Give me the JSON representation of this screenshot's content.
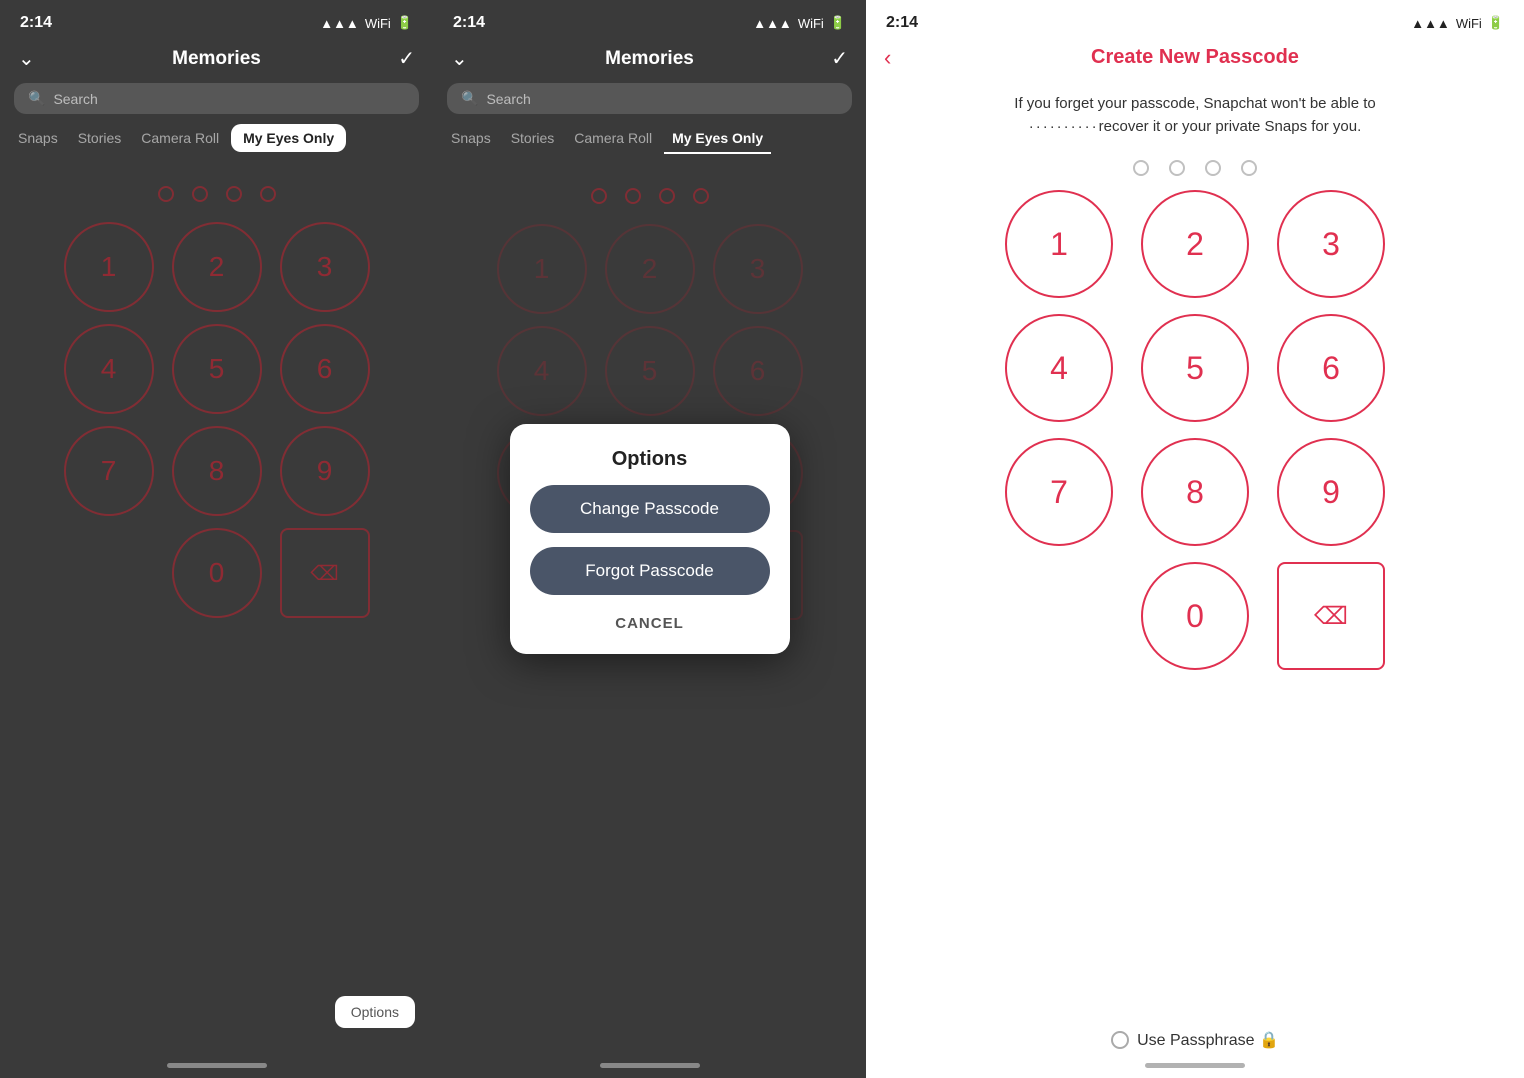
{
  "panel1": {
    "time": "2:14",
    "title": "Memories",
    "search_placeholder": "Search",
    "tabs": [
      "Snaps",
      "Stories",
      "Camera Roll",
      "My Eyes Only"
    ],
    "active_tab": "My Eyes Only",
    "options_label": "Options"
  },
  "panel2": {
    "time": "2:14",
    "title": "Memories",
    "search_placeholder": "Search",
    "tabs": [
      "Snaps",
      "Stories",
      "Camera Roll",
      "My Eyes Only"
    ],
    "active_tab": "My Eyes Only",
    "dialog": {
      "title": "Options",
      "change_passcode": "Change Passcode",
      "forgot_passcode": "Forgot Passcode",
      "cancel": "CANCEL"
    }
  },
  "panel3": {
    "time": "2:14",
    "title": "Create New Passcode",
    "info_text": "If you forget your passcode, Snapchat won't be able to\n··········recover it or your private Snaps for you.",
    "use_passphrase": "Use Passphrase 🔒",
    "numpad": [
      "1",
      "2",
      "3",
      "4",
      "5",
      "6",
      "7",
      "8",
      "9",
      "0",
      "⌫"
    ]
  }
}
